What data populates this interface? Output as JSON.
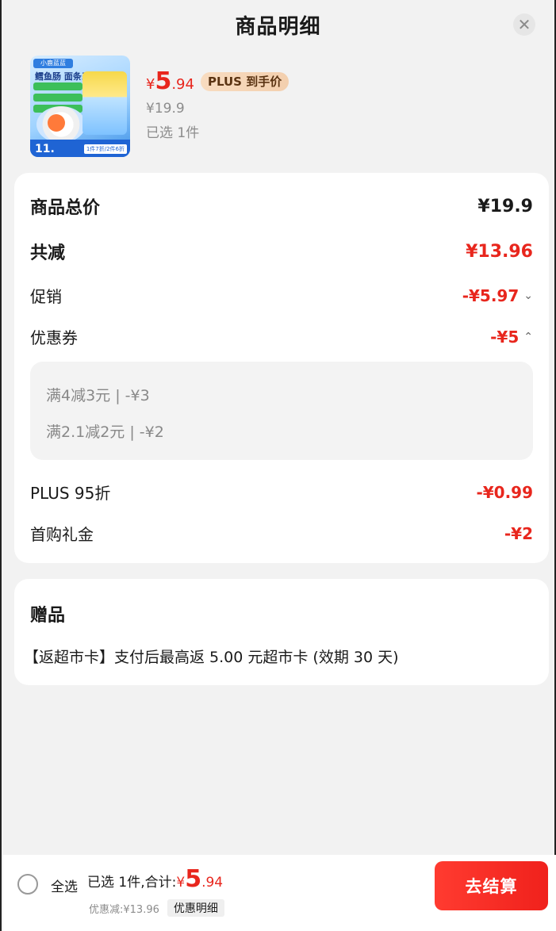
{
  "header": {
    "title": "商品明细",
    "close_icon": "close-icon"
  },
  "product": {
    "price_symbol": "¥",
    "price_int": "5",
    "price_dec": ".94",
    "plus_tag": "PLUS 到手价",
    "original_price": "¥19.9",
    "selected": "已选 1件",
    "thumbnail": {
      "badge": "小鹿蓝蓝",
      "title": "鳕鱼肠 面条系列",
      "price": "11.",
      "promo": "1件7折/2件6折"
    }
  },
  "summary": {
    "total_label": "商品总价",
    "total_value": "¥19.9",
    "reduce_label": "共减",
    "reduce_value": "¥13.96",
    "promo_label": "促销",
    "promo_value": "-¥5.97",
    "coupon_label": "优惠券",
    "coupon_value": "-¥5",
    "coupons": [
      "满4减3元 | -¥3",
      "满2.1减2元 | -¥2"
    ],
    "plus_label": "PLUS 95折",
    "plus_value": "-¥0.99",
    "gift_money_label": "首购礼金",
    "gift_money_value": "-¥2"
  },
  "gift": {
    "title": "赠品",
    "text": "【返超市卡】支付后最高返 5.00 元超市卡 (效期 30 天)"
  },
  "bottom": {
    "select_all": "全选",
    "sum_prefix": "已选 1件,合计:",
    "sum_symbol": "¥",
    "sum_int": "5",
    "sum_dec": ".94",
    "discount": "优惠减:¥13.96",
    "detail_link": "优惠明细",
    "checkout": "去结算"
  },
  "colors": {
    "accent": "#e8261d",
    "plus_tag_bg": "#f5d5b6"
  }
}
